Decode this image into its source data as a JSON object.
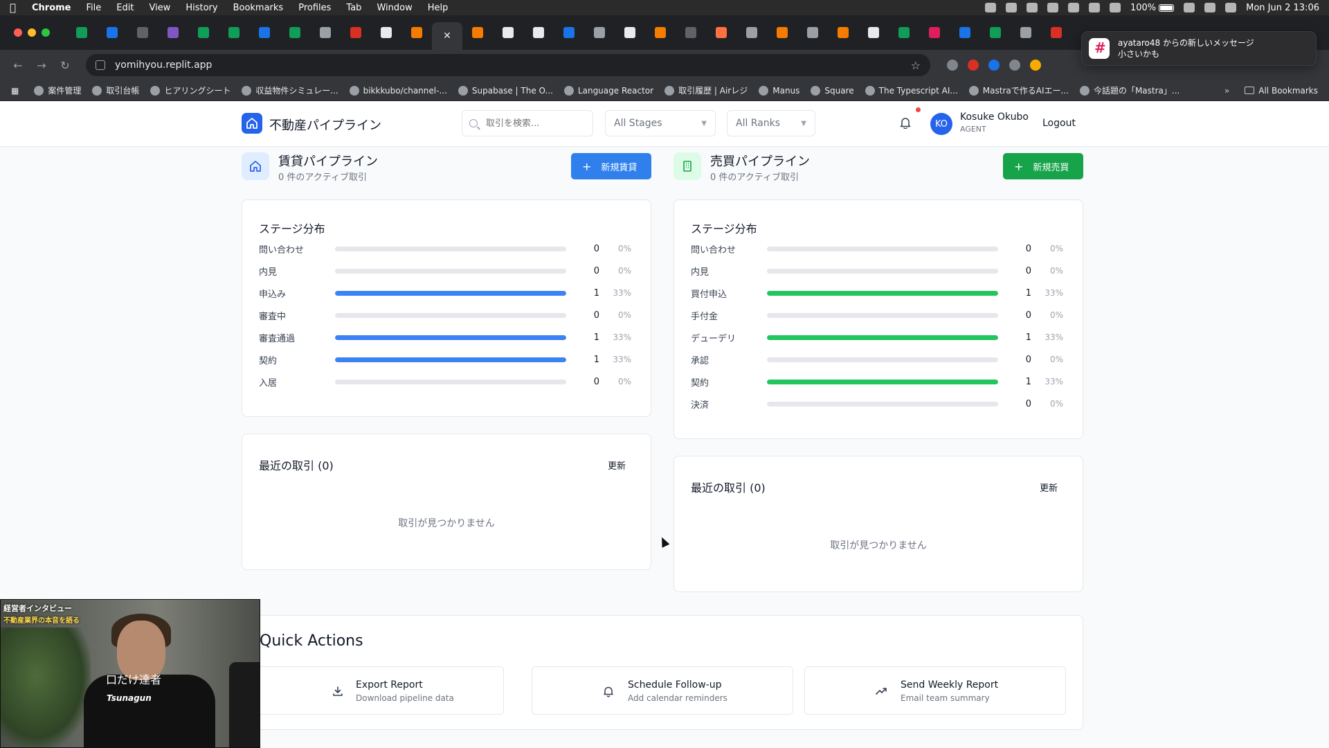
{
  "menubar": {
    "app": "Chrome",
    "items": [
      "File",
      "Edit",
      "View",
      "History",
      "Bookmarks",
      "Profiles",
      "Tab",
      "Window",
      "Help"
    ],
    "battery": "100%",
    "datetime": "Mon Jun 2  13:06"
  },
  "browser": {
    "url": "yomihyou.replit.app",
    "tab_close_glyph": "✕",
    "bookmarks": [
      "案件管理",
      "取引台帳",
      "ヒアリングシート",
      "収益物件シミュレー...",
      "bikkkubo/channel-...",
      "Supabase | The O...",
      "Language Reactor",
      "取引履歴 | Airレジ",
      "Manus",
      "Square",
      "The Typescript AI...",
      "Mastraで作るAIエー...",
      "今話題の「Mastra」..."
    ],
    "all_bookmarks": "All Bookmarks"
  },
  "notification": {
    "title": "ayataro48 からの新しいメッセージ",
    "body": "小さいかも"
  },
  "header": {
    "title": "不動産パイプライン",
    "search_placeholder": "取引を検索...",
    "stage_filter": "All Stages",
    "rank_filter": "All Ranks",
    "avatar_initials": "KO",
    "user_name": "Kosuke Okubo",
    "user_role": "AGENT",
    "logout": "Logout"
  },
  "rental": {
    "title": "賃貸パイプライン",
    "subtitle": "0 件のアクティブ取引",
    "new_button": "新規賃貸",
    "accent": "#3b82f6",
    "button_color": "#2f80ed",
    "distribution_title": "ステージ分布",
    "stages": [
      {
        "label": "問い合わせ",
        "count": "0",
        "pct": "0%",
        "fill": 0
      },
      {
        "label": "内見",
        "count": "0",
        "pct": "0%",
        "fill": 0
      },
      {
        "label": "申込み",
        "count": "1",
        "pct": "33%",
        "fill": 1
      },
      {
        "label": "審査中",
        "count": "0",
        "pct": "0%",
        "fill": 0
      },
      {
        "label": "審査通過",
        "count": "1",
        "pct": "33%",
        "fill": 1
      },
      {
        "label": "契約",
        "count": "1",
        "pct": "33%",
        "fill": 1
      },
      {
        "label": "入居",
        "count": "0",
        "pct": "0%",
        "fill": 0
      }
    ],
    "recent_title": "最近の取引 (0)",
    "refresh": "更新",
    "empty": "取引が見つかりません"
  },
  "sales": {
    "title": "売買パイプライン",
    "subtitle": "0 件のアクティブ取引",
    "new_button": "新規売買",
    "accent": "#22c55e",
    "button_color": "#16a34a",
    "distribution_title": "ステージ分布",
    "stages": [
      {
        "label": "問い合わせ",
        "count": "0",
        "pct": "0%",
        "fill": 0
      },
      {
        "label": "内見",
        "count": "0",
        "pct": "0%",
        "fill": 0
      },
      {
        "label": "買付申込",
        "count": "1",
        "pct": "33%",
        "fill": 1
      },
      {
        "label": "手付金",
        "count": "0",
        "pct": "0%",
        "fill": 0
      },
      {
        "label": "デューデリ",
        "count": "1",
        "pct": "33%",
        "fill": 1
      },
      {
        "label": "承認",
        "count": "0",
        "pct": "0%",
        "fill": 0
      },
      {
        "label": "契約",
        "count": "1",
        "pct": "33%",
        "fill": 1
      },
      {
        "label": "決済",
        "count": "0",
        "pct": "0%",
        "fill": 0
      }
    ],
    "recent_title": "最近の取引 (0)",
    "refresh": "更新",
    "empty": "取引が見つかりません"
  },
  "quick_actions": {
    "title": "Quick Actions",
    "items": [
      {
        "label": "Export Report",
        "sub": "Download pipeline data",
        "icon": "download-icon"
      },
      {
        "label": "Schedule Follow-up",
        "sub": "Add calendar reminders",
        "icon": "bell-icon"
      },
      {
        "label": "Send Weekly Report",
        "sub": "Email team summary",
        "icon": "trending-up-icon"
      }
    ]
  },
  "webcam": {
    "caption_top": "経営者インタビュー",
    "caption_sub": "不動産業界の本音を語る",
    "caption_mid": "口だけ達者",
    "shirt_text": "Tsunagun"
  }
}
